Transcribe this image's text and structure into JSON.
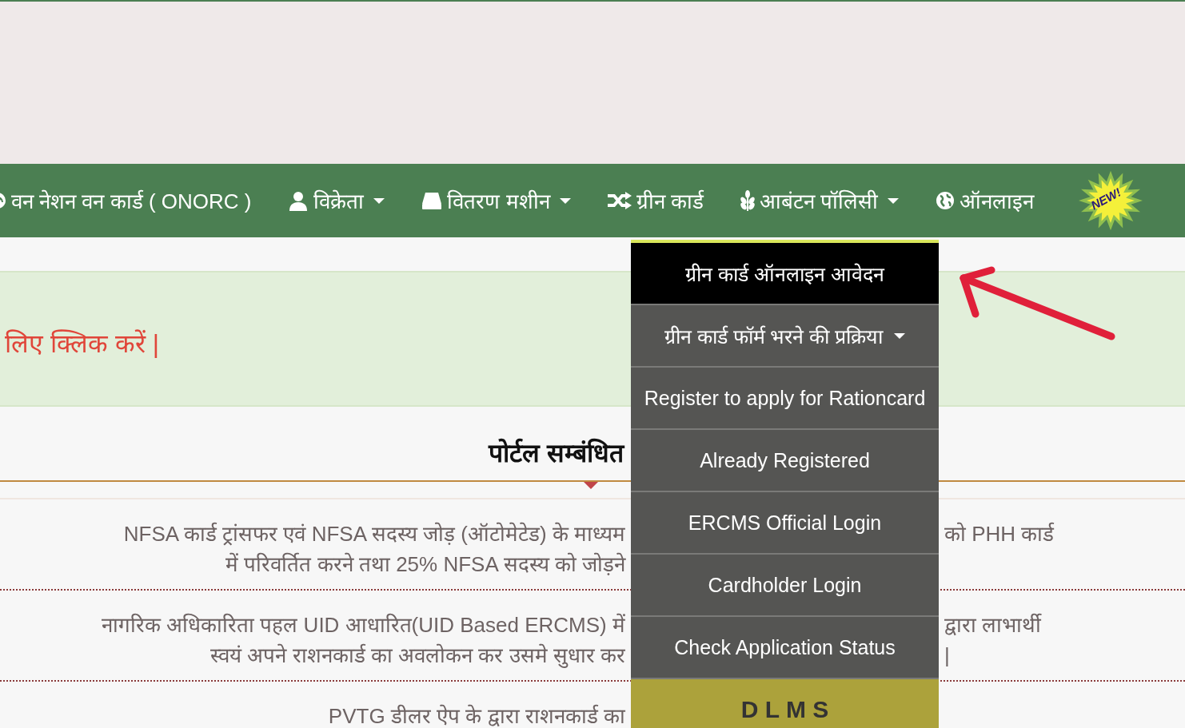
{
  "nav": {
    "items": [
      {
        "label": "वन नेशन वन कार्ड ( ONORC )",
        "kind": "gauge",
        "caret": false
      },
      {
        "label": "विक्रेता",
        "kind": "user",
        "caret": true
      },
      {
        "label": "वितरण मशीन",
        "kind": "drive",
        "caret": true
      },
      {
        "label": "ग्रीन कार्ड",
        "kind": "shuffle",
        "caret": false
      },
      {
        "label": "आबंटन पॉलिसी",
        "kind": "plant",
        "caret": true
      },
      {
        "label": "ऑनलाइन",
        "kind": "globe",
        "caret": false,
        "badge": "NEW!"
      }
    ]
  },
  "banner": {
    "text": "लिए क्लिक करें |"
  },
  "section": {
    "title": "पोर्टल सम्बंधित",
    "paragraphs": [
      {
        "lines": [
          {
            "left": "NFSA कार्ड ट्रांसफर एवं NFSA सदस्य जोड़ (ऑटोमेटेड) के माध्यम",
            "right": "को PHH कार्ड"
          },
          {
            "left": "में परिवर्तित करने तथा 25% NFSA सदस्य को जोड़ने"
          }
        ]
      },
      {
        "lines": [
          {
            "left": "नागरिक अधिकारिता पहल UID आधारित(UID Based ERCMS) में",
            "right": "द्वारा लाभार्थी"
          },
          {
            "left": "स्वयं अपने राशनकार्ड का अवलोकन कर उसमे सुधार कर",
            "right": "|"
          }
        ]
      },
      {
        "lines": [
          {
            "left": "PVTG डीलर ऐप के द्वारा राशनकार्ड का"
          }
        ]
      }
    ]
  },
  "dropdown": {
    "items": [
      {
        "label": "ग्रीन कार्ड ऑनलाइन आवेदन",
        "kind": "link",
        "selected": true,
        "caret": false
      },
      {
        "label": "ग्रीन कार्ड फॉर्म भरने की प्रक्रिया",
        "kind": "link",
        "selected": false,
        "caret": true
      },
      {
        "label": "Register to apply for Rationcard",
        "kind": "link",
        "selected": false,
        "caret": false
      },
      {
        "label": "Already Registered",
        "kind": "link",
        "selected": false,
        "caret": false
      },
      {
        "label": "ERCMS Official Login",
        "kind": "link",
        "selected": false,
        "caret": false
      },
      {
        "label": "Cardholder Login",
        "kind": "link",
        "selected": false,
        "caret": false
      },
      {
        "label": "Check Application Status",
        "kind": "link",
        "selected": false,
        "caret": false
      },
      {
        "label": "D L M S",
        "kind": "highlight",
        "selected": false,
        "caret": false
      }
    ]
  }
}
